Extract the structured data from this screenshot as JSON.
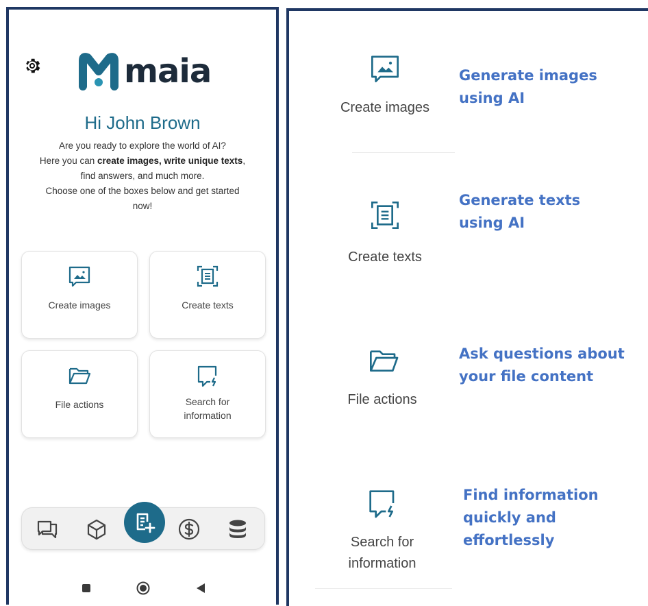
{
  "left": {
    "logo_text": "maia",
    "greeting": "Hi John Brown",
    "intro": {
      "line1": "Are you ready to explore the world of AI?",
      "line2_prefix": "Here you can ",
      "line2_bold": "create images, write unique texts",
      "line2_suffix": ",",
      "line3": "find answers, and much more.",
      "line4": "Choose one of the boxes below and get started",
      "line5": "now!"
    },
    "cards": {
      "images": "Create images",
      "texts": "Create texts",
      "files": "File actions",
      "search_line1": "Search for",
      "search_line2": "information"
    },
    "icons": {
      "settings": "gear-icon",
      "images": "image-icon",
      "texts": "document-icon",
      "files": "folder-icon",
      "search": "chat-bolt-icon",
      "nav_chat": "chat-icon",
      "nav_cube": "cube-icon",
      "nav_fab": "new-document-icon",
      "nav_dollar": "dollar-icon",
      "nav_db": "database-icon"
    }
  },
  "right": {
    "rows": [
      {
        "label_line1": "Create images",
        "label_line2": "",
        "desc": [
          "Generate images",
          "using AI"
        ]
      },
      {
        "label_line1": "Create texts",
        "label_line2": "",
        "desc": [
          "Generate texts",
          "using AI"
        ]
      },
      {
        "label_line1": "File actions",
        "label_line2": "",
        "desc": [
          "Ask questions about",
          "your file content"
        ]
      },
      {
        "label_line1": "Search for",
        "label_line2": "information",
        "desc": [
          "Find information",
          "quickly and",
          "effortlessly"
        ]
      }
    ]
  },
  "colors": {
    "brand": "#1e6b8a",
    "accent_blue": "#4472c4",
    "border": "#1f3763"
  }
}
